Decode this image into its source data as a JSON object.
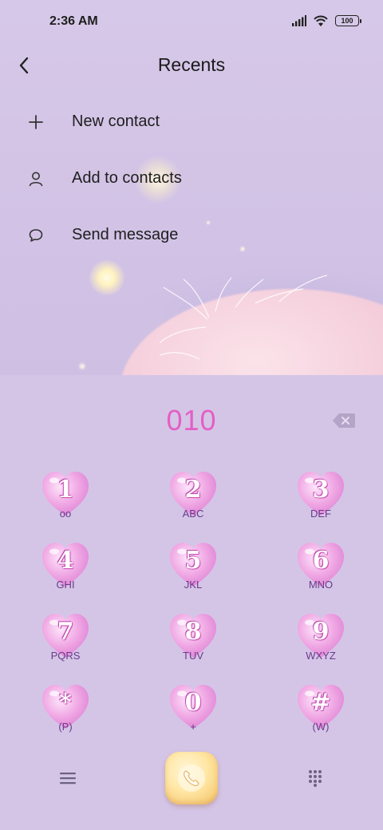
{
  "status_bar": {
    "time": "2:36 AM",
    "battery": "100",
    "icons": [
      "signal-icon",
      "wifi-icon",
      "battery-icon"
    ]
  },
  "header": {
    "title": "Recents",
    "back_icon": "chevron-left-icon"
  },
  "menu": {
    "items": [
      {
        "label": "New contact",
        "icon": "plus-icon"
      },
      {
        "label": "Add to contacts",
        "icon": "person-icon"
      },
      {
        "label": "Send message",
        "icon": "chat-bubble-icon"
      }
    ]
  },
  "dialpad": {
    "number": "010",
    "keys": [
      {
        "digit": "1",
        "letters": "oo"
      },
      {
        "digit": "2",
        "letters": "ABC"
      },
      {
        "digit": "3",
        "letters": "DEF"
      },
      {
        "digit": "4",
        "letters": "GHI"
      },
      {
        "digit": "5",
        "letters": "JKL"
      },
      {
        "digit": "6",
        "letters": "MNO"
      },
      {
        "digit": "7",
        "letters": "PQRS"
      },
      {
        "digit": "8",
        "letters": "TUV"
      },
      {
        "digit": "9",
        "letters": "WXYZ"
      },
      {
        "digit": "*",
        "letters": "(P)"
      },
      {
        "digit": "0",
        "letters": "+"
      },
      {
        "digit": "#",
        "letters": "(W)"
      }
    ]
  },
  "bottom_bar": {
    "menu_icon": "hamburger-menu-icon",
    "call_icon": "phone-icon",
    "dialpad_icon": "dialpad-grid-icon"
  },
  "colors": {
    "background": "#d3c5e6",
    "number": "#e45fc4",
    "heart": "#f0a8e4",
    "call_button": "#ffe7a5"
  }
}
